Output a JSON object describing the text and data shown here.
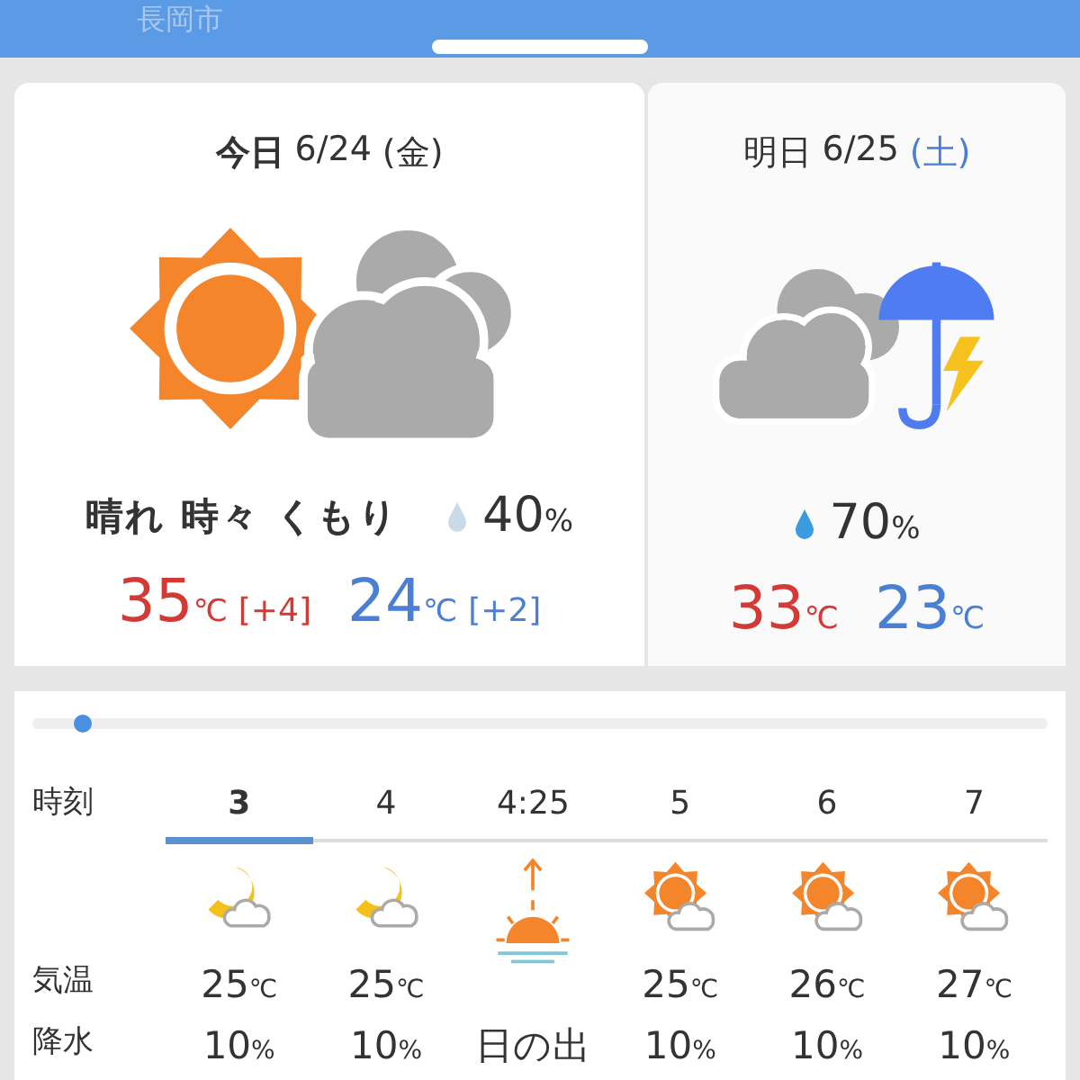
{
  "tabs": [
    {
      "label": "長岡市",
      "selected": false
    },
    {
      "selected": true
    }
  ],
  "days": [
    {
      "label": "今日",
      "date": "6/24",
      "weekday": "(金)",
      "color": "#333333",
      "kind": "sun-cloud",
      "condition": "晴れ 時々 くもり",
      "precip": "40",
      "precip_unit": "%",
      "high": "35",
      "high_unit": "℃",
      "high_diff": "[+4]",
      "low": "24",
      "low_unit": "℃",
      "low_diff": "[+2]",
      "selected": true
    },
    {
      "label": "明日",
      "date": "6/25",
      "weekday": "(土)",
      "color": "#4a7fd4",
      "kind": "cloud-thunder",
      "precip": "70",
      "precip_unit": "%",
      "high": "33",
      "high_unit": "℃",
      "low": "23",
      "low_unit": "℃",
      "selected": false
    }
  ],
  "timeline": {
    "level": 0.04
  },
  "hourly": {
    "row_labels": [
      "時刻",
      "気温",
      "降水"
    ],
    "columns": [
      {
        "time": "3",
        "kind": "moon-cloud",
        "temp": "25",
        "temp_unit": "℃",
        "precip": "10",
        "precip_unit": "%",
        "selected": true
      },
      {
        "time": "4",
        "kind": "moon-cloud",
        "temp": "25",
        "temp_unit": "℃",
        "precip": "10",
        "precip_unit": "%",
        "selected": false
      },
      {
        "time": "4:25",
        "kind": "sunrise",
        "precip": "日の出",
        "selected": false
      },
      {
        "time": "5",
        "kind": "sun-cloud",
        "temp": "25",
        "temp_unit": "℃",
        "precip": "10",
        "precip_unit": "%",
        "selected": false
      },
      {
        "time": "6",
        "kind": "sun-cloud",
        "temp": "26",
        "temp_unit": "℃",
        "precip": "10",
        "precip_unit": "%",
        "selected": false
      },
      {
        "time": "7",
        "kind": "sun-cloud",
        "temp": "27",
        "temp_unit": "℃",
        "precip": "10",
        "precip_unit": "%",
        "selected": false
      }
    ]
  }
}
